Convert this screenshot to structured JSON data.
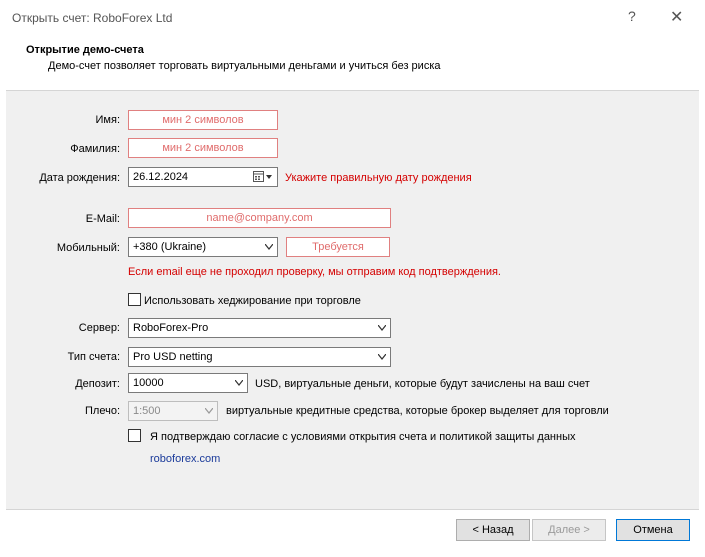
{
  "window": {
    "title": "Открыть счет: RoboForex Ltd",
    "help": "?",
    "close": "✕"
  },
  "header": {
    "title": "Открытие демо-счета",
    "subtitle": "Демо-счет позволяет торговать виртуальными деньгами и учиться без риска"
  },
  "form": {
    "first_name": {
      "label": "Имя:",
      "placeholder": "мин 2 символов"
    },
    "last_name": {
      "label": "Фамилия:",
      "placeholder": "мин 2 символов"
    },
    "birthdate": {
      "label": "Дата рождения:",
      "value": "26.12.2024",
      "error": "Укажите правильную дату рождения"
    },
    "email": {
      "label": "E-Mail:",
      "placeholder": "name@company.com"
    },
    "mobile": {
      "label": "Мобильный:",
      "country": "+380 (Ukraine)",
      "placeholder": "Требуется",
      "note": "Если email еще не проходил проверку, мы отправим код подтверждения."
    },
    "hedging": {
      "label": "Использовать хеджирование при торговле",
      "checked": false
    },
    "server": {
      "label": "Сервер:",
      "value": "RoboForex-Pro"
    },
    "account_type": {
      "label": "Тип счета:",
      "value": "Pro USD netting"
    },
    "deposit": {
      "label": "Депозит:",
      "value": "10000",
      "note": "USD, виртуальные деньги, которые будут зачислены на ваш счет"
    },
    "leverage": {
      "label": "Плечо:",
      "value": "1:500",
      "note": "виртуальные кредитные средства, которые брокер выделяет для торговли"
    },
    "agree": {
      "label": "Я подтверждаю согласие с условиями открытия счета и политикой защиты данных",
      "checked": false
    },
    "link": "roboforex.com"
  },
  "buttons": {
    "back": "< Назад",
    "next": "Далее >",
    "cancel": "Отмена"
  },
  "colors": {
    "error": "#d40000",
    "placeholder": "#e06c6c",
    "link": "#1a3a9a"
  }
}
